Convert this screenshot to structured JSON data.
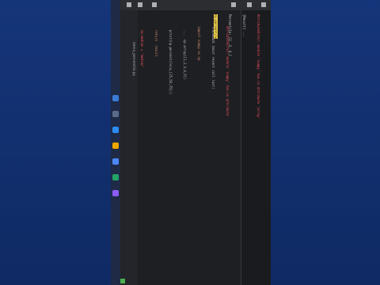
{
  "code": {
    "lines": [
      "AttributeError: module 'numpy' has no attribute",
      "Traceback (most recent call last)",
      "import numpy as np",
      "  ...  np.array([1,2,3,4,5])",
      "  print(np.percentile(a,[25,50,75]))",
      "  return  result",
      "  np.median = 'median'"
    ]
  },
  "console": {
    "lines": [
      "AttributeError: module 'numpy' has no attribute 'array'",
      "[Result] ...",
      "Percentile: [2. 3. 4.]",
      "print(np.percentile(a))"
    ],
    "highlight": "np.percentile"
  },
  "explorer": {
    "file_label": "demo_percentile.py"
  },
  "colors": {
    "accent": "#e0533b",
    "keyword": "#cf8e6d",
    "error": "#f75464",
    "highlight": "#f2d34a"
  }
}
